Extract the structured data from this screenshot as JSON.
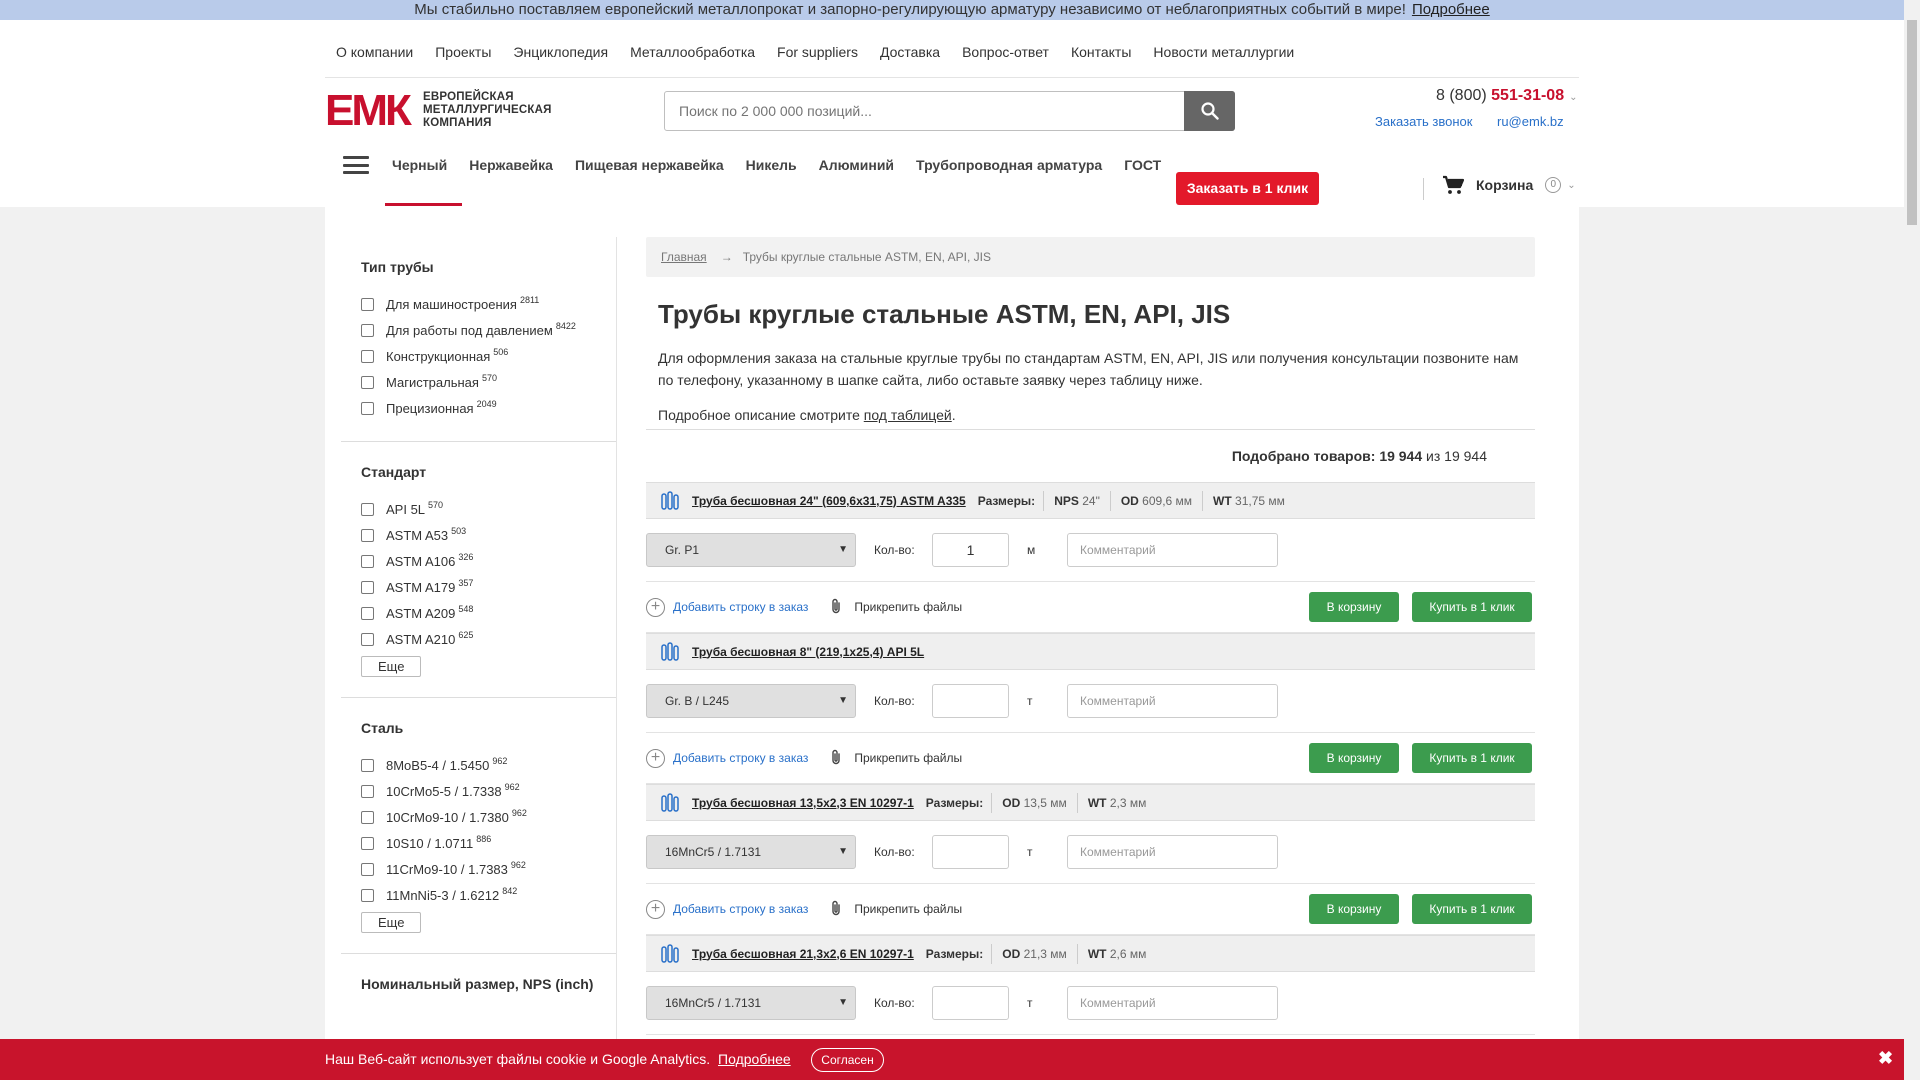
{
  "banner": {
    "text": "Мы стабильно поставляем европейский металлопрокат и запорно-регулирующую арматуру независимо от неблагоприятных событий в мире!",
    "link": "Подробнее"
  },
  "topnav": [
    "О компании",
    "Проекты",
    "Энциклопедия",
    "Металлообработка",
    "For suppliers",
    "Доставка",
    "Вопрос-ответ",
    "Контакты",
    "Новости металлургии"
  ],
  "logo": {
    "mark": "ЕМК",
    "line1": "ЕВРОПЕЙСКАЯ",
    "line2": "МЕТАЛЛУРГИЧЕСКАЯ",
    "line3": "КОМПАНИЯ"
  },
  "search": {
    "placeholder": "Поиск по 2 000 000 позиций..."
  },
  "contacts": {
    "phone_prefix": "8 (800)",
    "phone_main": "551-31-08",
    "callback": "Заказать звонок",
    "email": "ru@emk.bz"
  },
  "catnav": [
    "Черный",
    "Нержавейка",
    "Пищевая нержавейка",
    "Никель",
    "Алюминий",
    "Трубопроводная арматура",
    "ГОСТ"
  ],
  "oneclick": "Заказать в 1 клик",
  "cart": {
    "label": "Корзина",
    "count": "0"
  },
  "filters": [
    {
      "title": "Тип трубы",
      "items": [
        [
          "Для машиностроения",
          "2811"
        ],
        [
          "Для работы под давлением",
          "8422"
        ],
        [
          "Конструкционная",
          "506"
        ],
        [
          "Магистральная",
          "570"
        ],
        [
          "Прецизионная",
          "2049"
        ]
      ],
      "more": ""
    },
    {
      "title": "Стандарт",
      "items": [
        [
          "API 5L",
          "570"
        ],
        [
          "ASTM A53",
          "503"
        ],
        [
          "ASTM A106",
          "326"
        ],
        [
          "ASTM A179",
          "357"
        ],
        [
          "ASTM A209",
          "548"
        ],
        [
          "ASTM A210",
          "625"
        ]
      ],
      "more": "Еще"
    },
    {
      "title": "Сталь",
      "items": [
        [
          "8MoB5-4 / 1.5450",
          "962"
        ],
        [
          "10CrMo5-5 / 1.7338",
          "962"
        ],
        [
          "10CrMo9-10 / 1.7380",
          "962"
        ],
        [
          "10S10 / 1.0711",
          "886"
        ],
        [
          "11CrMo9-10 / 1.7383",
          "962"
        ],
        [
          "11MnNi5-3 / 1.6212",
          "842"
        ]
      ],
      "more": "Еще"
    },
    {
      "title": "Номинальный размер, NPS (inch)",
      "items": [],
      "more": ""
    }
  ],
  "breadcrumbs": {
    "home": "Главная",
    "arrow": "→",
    "current": "Трубы круглые стальные ASTM, EN, API, JIS"
  },
  "page_title": "Трубы круглые стальные ASTM, EN, API, JIS",
  "intro": "Для оформления заказа на стальные круглые трубы по стандартам ASTM, EN, API, JIS или получения консультации позвоните нам по телефону, указанному в шапке сайта, либо оставьте заявку через таблицу ниже.",
  "intro2": {
    "text": "Подробное описание смотрите",
    "link": "под таблицей",
    "end": "."
  },
  "found": {
    "label": "Подобрано товаров:",
    "count": "19 944",
    "of": "из",
    "total": "19 944"
  },
  "sizes_label": "Размеры:",
  "qty_label": "Кол-во:",
  "comment_placeholder": "Комментарий",
  "add_row": "Добавить строку в заказ",
  "attach": "Прикрепить файлы",
  "to_cart": "В корзину",
  "buy_one_click": "Купить в 1 клик",
  "products": [
    {
      "name": "Труба бесшовная 24\" (609,6x31,75) ASTM A335",
      "dims": [
        [
          "NPS",
          "24\""
        ],
        [
          "OD",
          "609,6 мм"
        ],
        [
          "WT",
          "31,75 мм"
        ]
      ],
      "grade": "Gr. P1",
      "qty": "1",
      "unit": "м"
    },
    {
      "name": "Труба бесшовная 8\" (219,1x25,4) API 5L",
      "dims": [],
      "grade": "Gr. B / L245",
      "qty": "",
      "unit": "т"
    },
    {
      "name": "Труба бесшовная 13,5x2,3 EN 10297-1",
      "dims": [
        [
          "OD",
          "13,5 мм"
        ],
        [
          "WT",
          "2,3 мм"
        ]
      ],
      "grade": "16MnCr5 / 1.7131",
      "qty": "",
      "unit": "т"
    },
    {
      "name": "Труба бесшовная 21,3x2,6 EN 10297-1",
      "dims": [
        [
          "OD",
          "21,3 мм"
        ],
        [
          "WT",
          "2,6 мм"
        ]
      ],
      "grade": "16MnCr5 / 1.7131",
      "qty": "",
      "unit": "т"
    }
  ],
  "cookie": {
    "text": "Наш Веб-сайт использует файлы cookie и Google Analytics.",
    "link": "Подробнее",
    "agree": "Согласен",
    "close": "✖"
  }
}
